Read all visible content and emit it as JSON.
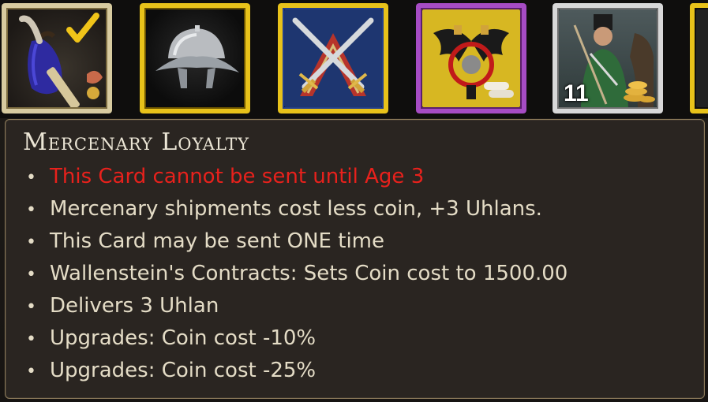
{
  "cards": [
    {
      "name": "Mercenary Loyalty",
      "icon": "coin-purse-checkmark-icon",
      "frame_color": "#d8cba0",
      "count": null
    },
    {
      "name": "",
      "icon": "steel-helmet-icon",
      "frame_color": "#e8c21a",
      "count": null
    },
    {
      "name": "",
      "icon": "crossed-swords-icon",
      "frame_color": "#e8c21a",
      "count": null
    },
    {
      "name": "",
      "icon": "double-eagle-crest-icon",
      "frame_color": "#a64cc4",
      "count": null
    },
    {
      "name": "",
      "icon": "uhlan-soldier-coins-icon",
      "frame_color": "#d8d8d8",
      "count": "11"
    },
    {
      "name": "",
      "icon": "partial-card-icon",
      "frame_color": "#e8c21a",
      "count": null
    }
  ],
  "tooltip": {
    "title": "Mercenary Loyalty",
    "bullet": "•",
    "lines": [
      {
        "text": "This Card cannot be sent until Age 3",
        "color": "#e8211c"
      },
      {
        "text": "Mercenary shipments cost less coin, +3 Uhlans."
      },
      {
        "text": "This Card may be sent ONE time"
      },
      {
        "text": "Wallenstein's Contracts: Sets Coin cost to 1500.00"
      },
      {
        "text": "Delivers 3 Uhlan"
      },
      {
        "text": "Upgrades: Coin cost -10%"
      },
      {
        "text": "Upgrades: Coin cost -25%"
      }
    ]
  }
}
